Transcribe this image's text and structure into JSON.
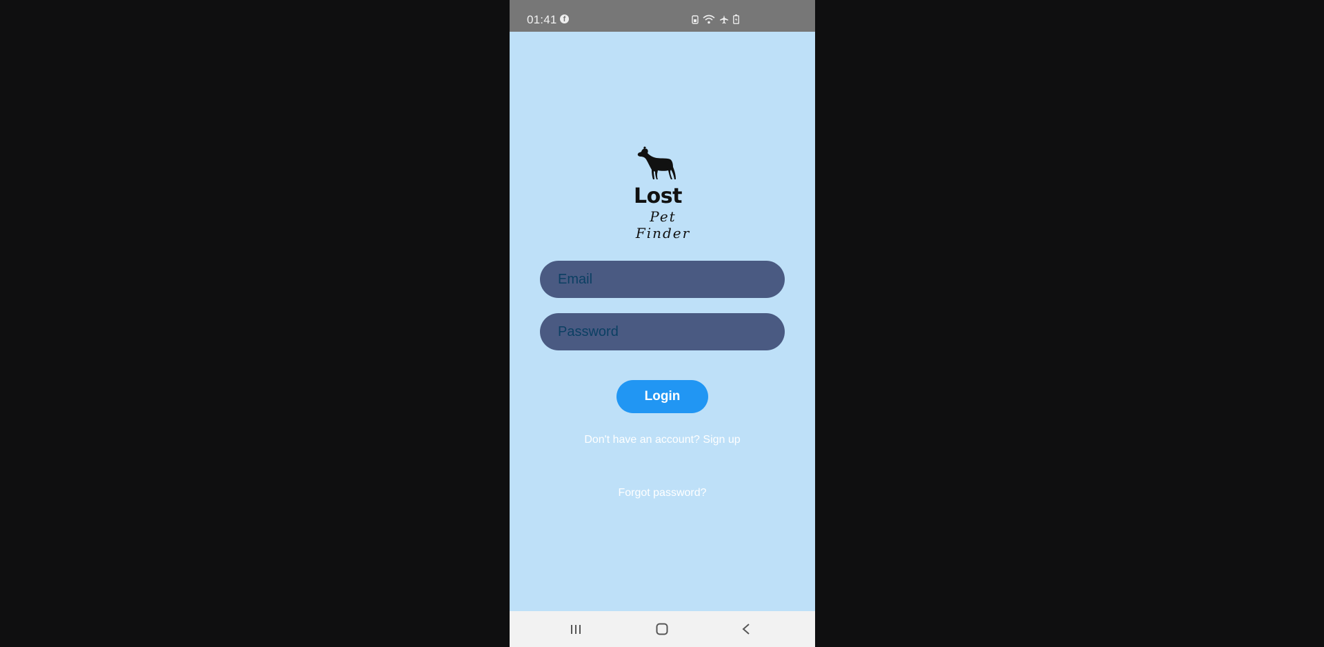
{
  "status_bar": {
    "time": "01:41",
    "icons": [
      "facebook-icon",
      "sim-icon",
      "wifi-icon",
      "airplane-mode-icon",
      "battery-icon"
    ]
  },
  "logo": {
    "title": "Lost",
    "subtitle": "Pet Finder",
    "icon": "dog-silhouette-icon"
  },
  "form": {
    "email_placeholder": "Email",
    "password_placeholder": "Password",
    "login_label": "Login"
  },
  "links": {
    "signup": "Don't have an account? Sign up",
    "forgot": "Forgot password?"
  },
  "nav": {
    "recents_icon": "recent-apps-icon",
    "home_icon": "home-icon",
    "back_icon": "back-icon"
  },
  "colors": {
    "background": "#bee0f8",
    "field": "#4a5a82",
    "button": "#2196f3",
    "status_bar": "#777777"
  }
}
